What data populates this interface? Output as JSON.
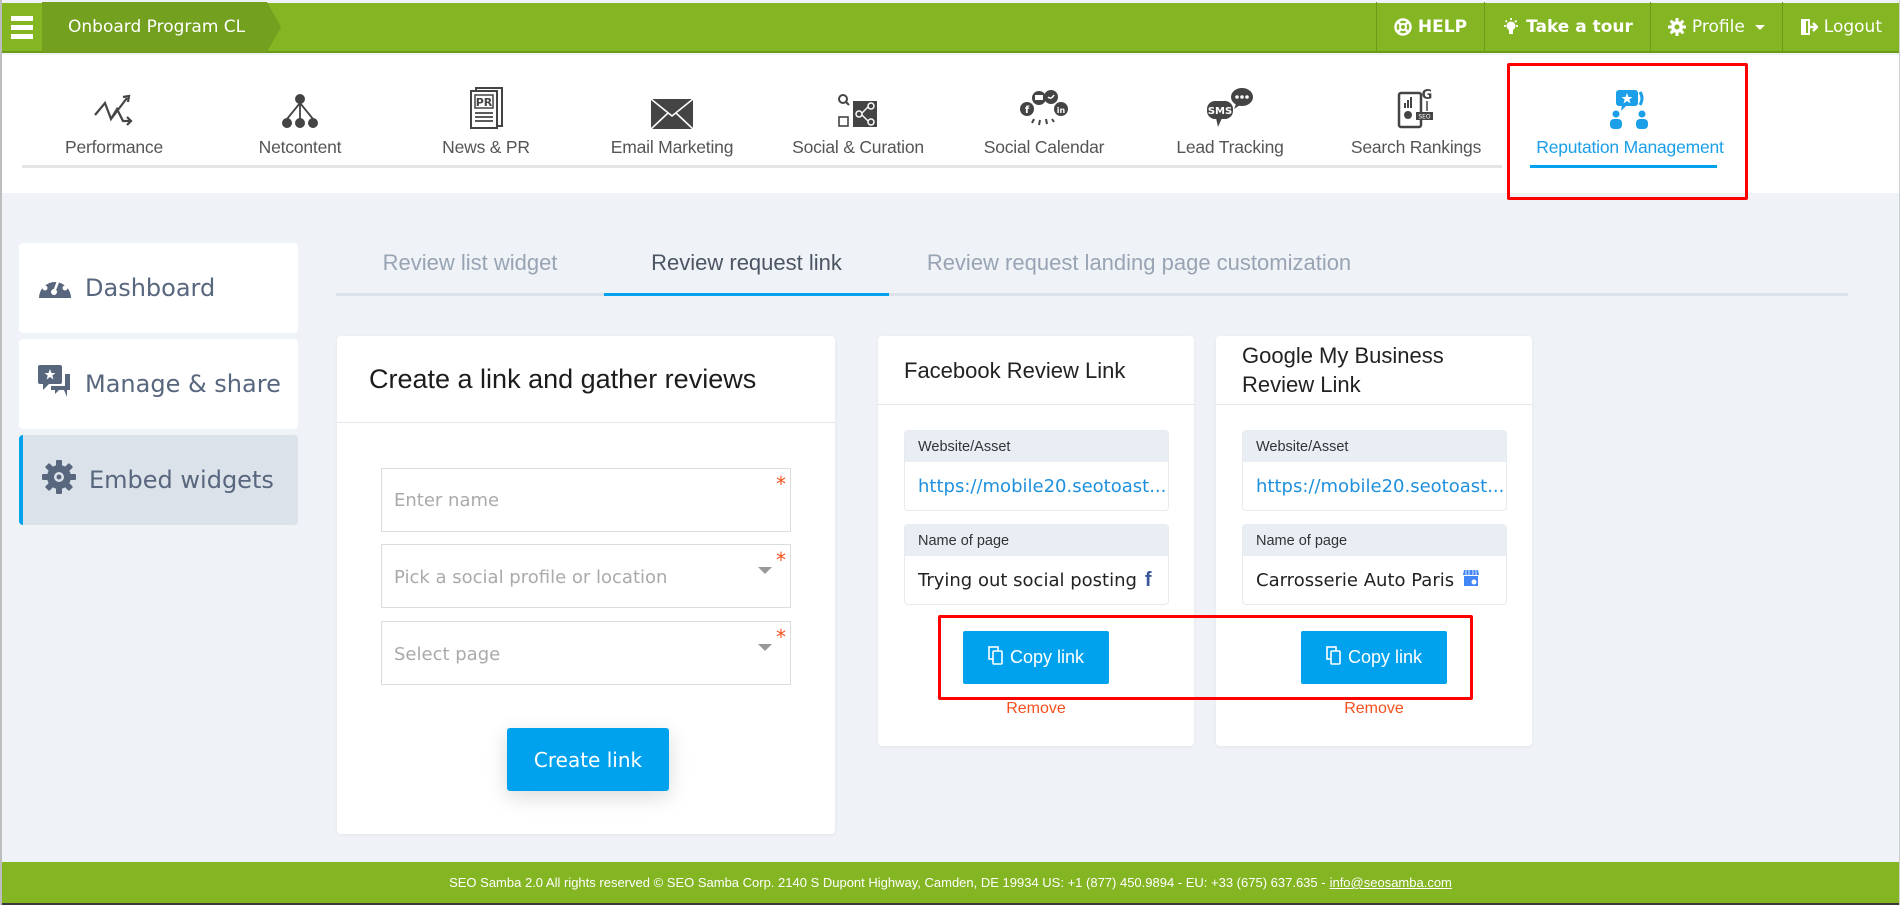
{
  "topbar": {
    "program_name": "Onboard Program CL",
    "help_label": "HELP",
    "tour_label": "Take a tour",
    "profile_label": "Profile",
    "logout_label": "Logout",
    "bar_color": "#84b523"
  },
  "modules": [
    {
      "label": "Performance",
      "icon": "performance-trend-icon"
    },
    {
      "label": "Netcontent",
      "icon": "network-tree-icon"
    },
    {
      "label": "News & PR",
      "icon": "pr-document-icon"
    },
    {
      "label": "Email Marketing",
      "icon": "envelope-icon"
    },
    {
      "label": "Social & Curation",
      "icon": "share-curation-icon"
    },
    {
      "label": "Social Calendar",
      "icon": "social-networks-icon"
    },
    {
      "label": "Lead Tracking",
      "icon": "sms-chat-icon"
    },
    {
      "label": "Search Rankings",
      "icon": "seo-rankings-icon"
    },
    {
      "label": "Reputation Management",
      "icon": "reputation-people-icon",
      "active": true
    }
  ],
  "sidebar": {
    "items": [
      {
        "label": "Dashboard",
        "icon": "dashboard-gauge-icon"
      },
      {
        "label": "Manage & share",
        "icon": "review-chat-star-icon"
      },
      {
        "label": "Embed widgets",
        "icon": "gear-icon",
        "active": true
      }
    ]
  },
  "tabs": [
    {
      "label": "Review list widget"
    },
    {
      "label": "Review request link",
      "active": true
    },
    {
      "label": "Review request landing page customization"
    }
  ],
  "create_form": {
    "title": "Create a link and gather reviews",
    "name_placeholder": "Enter name",
    "profile_placeholder": "Pick a social profile or location",
    "page_placeholder": "Select page",
    "required_mark": "*",
    "submit_label": "Create link"
  },
  "link_cards": [
    {
      "title": "Facebook Review Link",
      "website_label": "Website/Asset",
      "website_value": "https://mobile20.seotoast...",
      "page_label": "Name of page",
      "page_value": "Trying out social posting",
      "page_icon": "facebook-icon",
      "copy_label": "Copy link",
      "remove_label": "Remove"
    },
    {
      "title": "Google My Business Review Link",
      "website_label": "Website/Asset",
      "website_value": "https://mobile20.seotoast...",
      "page_label": "Name of page",
      "page_value": "Carrosserie Auto Paris",
      "page_icon": "google-my-business-icon",
      "copy_label": "Copy link",
      "remove_label": "Remove"
    }
  ],
  "footer": {
    "text": "SEO Samba 2.0  All rights reserved © SEO Samba Corp. 2140 S Dupont Highway, Camden, DE 19934 US: +1 (877) 450.9894 - EU: +33 (675) 637.635 -",
    "email": "info@seosamba.com"
  },
  "colors": {
    "accent_blue": "#00a2ee",
    "danger": "#f4511e",
    "annotation_red": "#ff0000"
  }
}
